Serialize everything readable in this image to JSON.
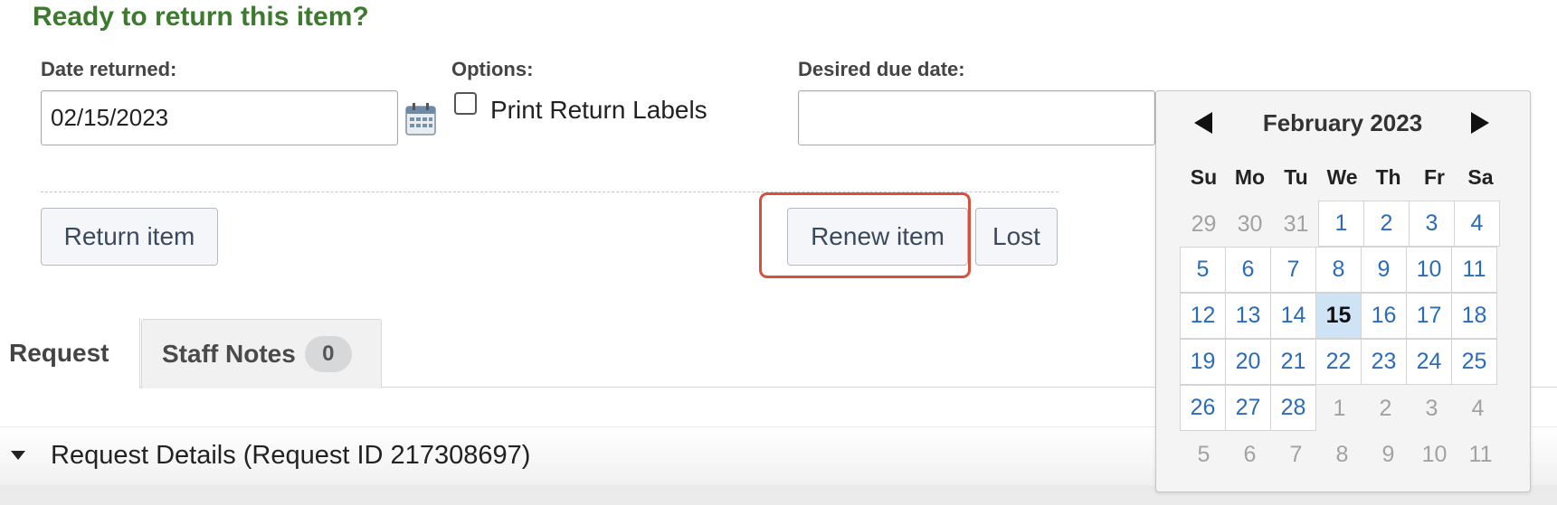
{
  "heading": "Ready to return this item?",
  "form": {
    "date_returned_label": "Date returned:",
    "date_returned_value": "02/15/2023",
    "options_label": "Options:",
    "print_labels_text": "Print Return Labels",
    "print_labels_checked": false,
    "due_date_label": "Desired due date:",
    "due_date_value": ""
  },
  "buttons": {
    "return": "Return item",
    "renew": "Renew item",
    "lost": "Lost"
  },
  "tabs": {
    "request": "Request",
    "staff_notes": "Staff Notes",
    "staff_notes_count": "0"
  },
  "details": {
    "text": "Request Details (Request ID 217308697)"
  },
  "datepicker": {
    "title": "February 2023",
    "weekdays": [
      "Su",
      "Mo",
      "Tu",
      "We",
      "Th",
      "Fr",
      "Sa"
    ],
    "today": "15",
    "weeks": [
      [
        [
          "29",
          "out"
        ],
        [
          "30",
          "out"
        ],
        [
          "31",
          "out"
        ],
        [
          "1",
          "in"
        ],
        [
          "2",
          "in"
        ],
        [
          "3",
          "in"
        ],
        [
          "4",
          "in"
        ]
      ],
      [
        [
          "5",
          "in"
        ],
        [
          "6",
          "in"
        ],
        [
          "7",
          "in"
        ],
        [
          "8",
          "in"
        ],
        [
          "9",
          "in"
        ],
        [
          "10",
          "in"
        ],
        [
          "11",
          "in"
        ]
      ],
      [
        [
          "12",
          "in"
        ],
        [
          "13",
          "in"
        ],
        [
          "14",
          "in"
        ],
        [
          "15",
          "in"
        ],
        [
          "16",
          "in"
        ],
        [
          "17",
          "in"
        ],
        [
          "18",
          "in"
        ]
      ],
      [
        [
          "19",
          "in"
        ],
        [
          "20",
          "in"
        ],
        [
          "21",
          "in"
        ],
        [
          "22",
          "in"
        ],
        [
          "23",
          "in"
        ],
        [
          "24",
          "in"
        ],
        [
          "25",
          "in"
        ]
      ],
      [
        [
          "26",
          "in"
        ],
        [
          "27",
          "in"
        ],
        [
          "28",
          "in"
        ],
        [
          "1",
          "out"
        ],
        [
          "2",
          "out"
        ],
        [
          "3",
          "out"
        ],
        [
          "4",
          "out"
        ]
      ],
      [
        [
          "5",
          "out"
        ],
        [
          "6",
          "out"
        ],
        [
          "7",
          "out"
        ],
        [
          "8",
          "out"
        ],
        [
          "9",
          "out"
        ],
        [
          "10",
          "out"
        ],
        [
          "11",
          "out"
        ]
      ]
    ]
  },
  "colors": {
    "heading": "#3c7a2e",
    "link_day": "#2b6cb8",
    "highlight": "#d9503f"
  }
}
